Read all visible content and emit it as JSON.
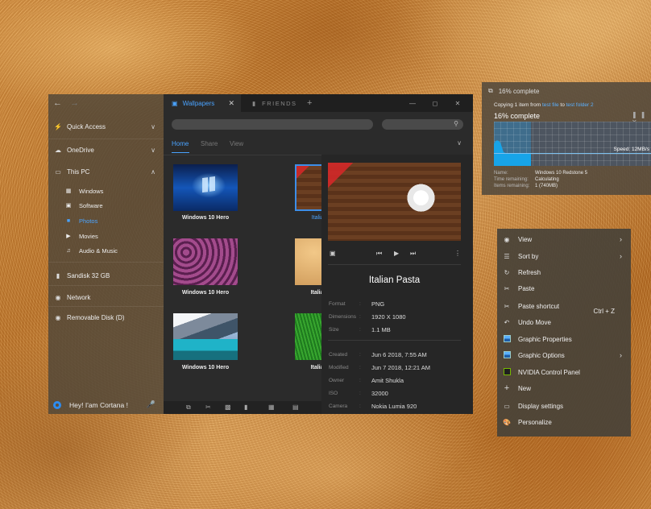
{
  "sidebar": {
    "items": {
      "quick_access": "Quick Access",
      "onedrive": "OneDrive",
      "this_pc": "This PC",
      "sandisk": "Sandisk 32 GB",
      "network": "Network",
      "removable": "Removable Disk (D)"
    },
    "sub_items": [
      "Windows",
      "Software",
      "Photos",
      "Movies",
      "Audio & Music"
    ],
    "cortana": "Hey! I'am Cortana !"
  },
  "tabs": {
    "active": "Wallpapers",
    "inactive": "FRIENDS"
  },
  "ribbon": {
    "home": "Home",
    "share": "Share",
    "view": "View"
  },
  "thumbnails": [
    {
      "caption": "Windows 10 Hero"
    },
    {
      "caption": "Italian Salad"
    },
    {
      "caption": "Windows 10 Hero"
    },
    {
      "caption": "Italian Salad"
    },
    {
      "caption": "Windows 10 Hero"
    },
    {
      "caption": "Italian Salad"
    }
  ],
  "preview": {
    "title": "Italian Pasta",
    "props": {
      "format": {
        "label": "Format",
        "value": "PNG"
      },
      "dimensions": {
        "label": "Dimensions",
        "value": "1920 X 1080"
      },
      "size": {
        "label": "Size",
        "value": "1.1 MB"
      },
      "created": {
        "label": "Created",
        "value": "Jun 6 2018, 7:55 AM"
      },
      "modified": {
        "label": "Modified",
        "value": "Jun 7 2018, 12:21 AM"
      },
      "owner": {
        "label": "Owner",
        "value": "Amit Shukla"
      },
      "iso": {
        "label": "ISO",
        "value": "32000"
      },
      "camera": {
        "label": "Camera",
        "value": "Nokia Lumia 920"
      }
    }
  },
  "copy_dialog": {
    "title": "16% complete",
    "line_prefix": "Copying 1 item from",
    "from_link": "test file",
    "line_mid": "to",
    "to_link": "test folder 2",
    "percent_label": "16% complete",
    "percent": 16,
    "speed": "Speed: 12MB/s",
    "details": {
      "name": {
        "label": "Name:",
        "value": "Windows 10 Redstone 5"
      },
      "time": {
        "label": "Time remaining:",
        "value": "Calculating"
      },
      "items": {
        "label": "Items remaining:",
        "value": "1 (740MB)"
      }
    }
  },
  "context_menu": {
    "items": [
      {
        "label": "View",
        "icon": "eye-icon"
      },
      {
        "label": "Sort by",
        "icon": "list-icon"
      },
      {
        "label": "Refresh",
        "icon": "refresh-icon"
      },
      {
        "label": "Paste",
        "icon": "scissors-icon"
      },
      {
        "label": "Paste shortcut",
        "icon": "scissors-icon"
      },
      {
        "label": "Undo Move",
        "icon": "undo-icon",
        "shortcut": "Ctrl + Z"
      },
      {
        "label": "Graphic Properties",
        "icon": "graphics-icon"
      },
      {
        "label": "Graphic Options",
        "icon": "graphics-icon"
      },
      {
        "label": "NVIDIA Control Panel",
        "icon": "nvidia-icon"
      },
      {
        "label": "New",
        "icon": "plus-icon"
      },
      {
        "label": "Display settings",
        "icon": "monitor-icon"
      },
      {
        "label": "Personalize",
        "icon": "palette-icon"
      }
    ]
  },
  "colors": {
    "accent": "#3d8ee8",
    "link": "#5ab0ff"
  }
}
